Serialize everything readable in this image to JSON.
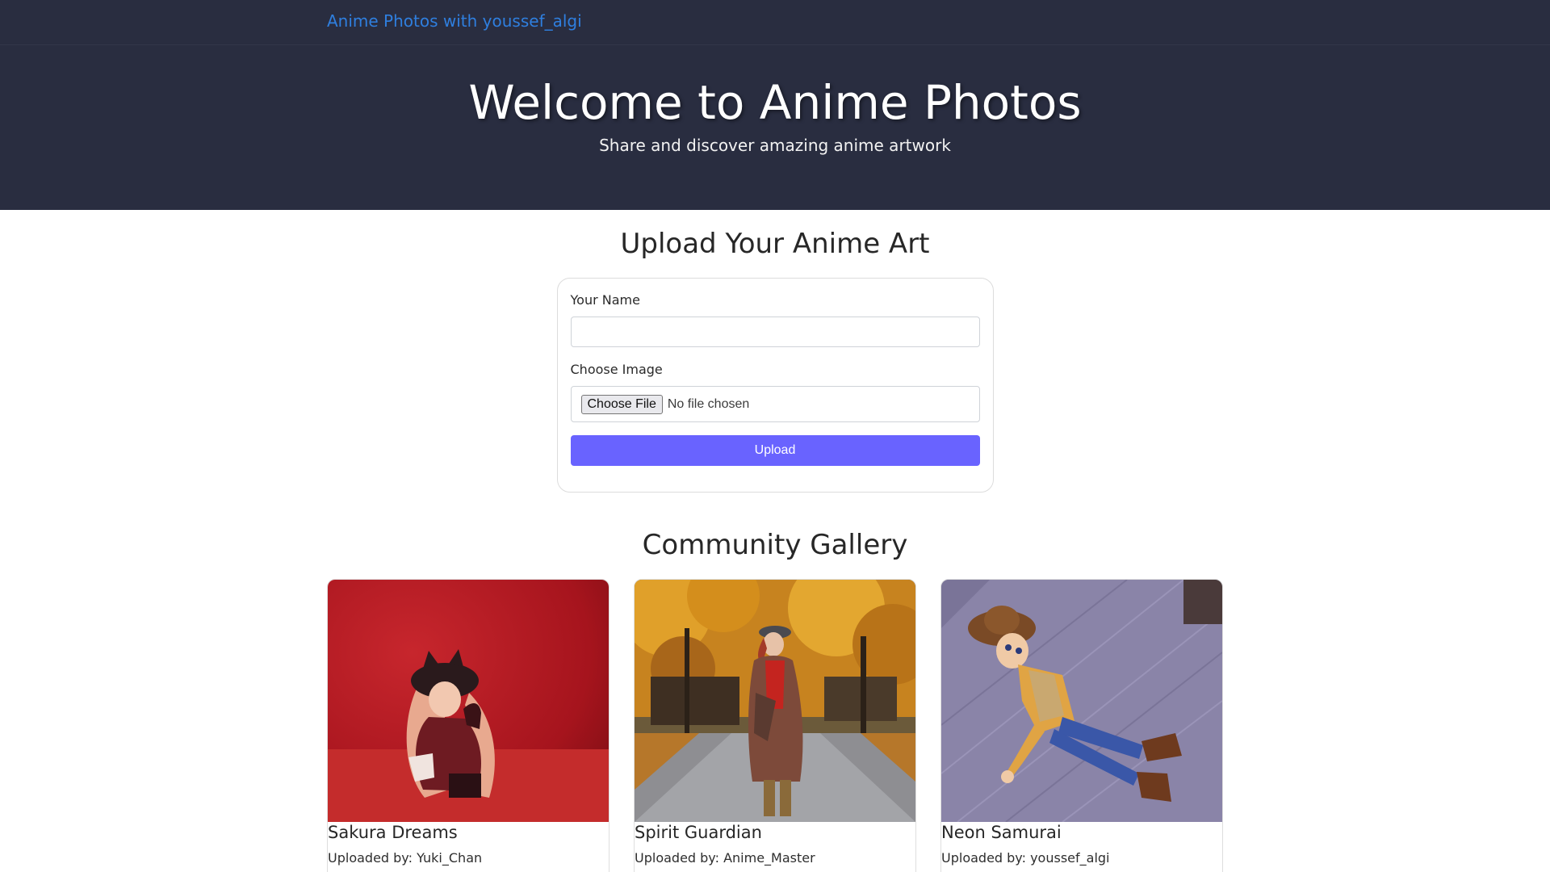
{
  "navbar": {
    "brand": "Anime Photos with youssef_algi"
  },
  "hero": {
    "title": "Welcome to Anime Photos",
    "subtitle": "Share and discover amazing anime artwork"
  },
  "upload": {
    "heading": "Upload Your Anime Art",
    "name_label": "Your Name",
    "name_value": "",
    "image_label": "Choose Image",
    "file_button": "Choose File",
    "file_status": "No file chosen",
    "submit_label": "Upload"
  },
  "gallery": {
    "heading": "Community Gallery",
    "items": [
      {
        "title": "Sakura Dreams",
        "uploader": "Uploaded by: Yuki_Chan",
        "image": "red-figure-photo"
      },
      {
        "title": "Spirit Guardian",
        "uploader": "Uploaded by: Anime_Master",
        "image": "autumn-park-photo"
      },
      {
        "title": "Neon Samurai",
        "uploader": "Uploaded by: youssef_algi",
        "image": "cowboy-toy-photo"
      }
    ]
  },
  "colors": {
    "header_bg": "#292d40",
    "brand_link": "#2f7fdf",
    "primary_button": "#6963ff"
  }
}
